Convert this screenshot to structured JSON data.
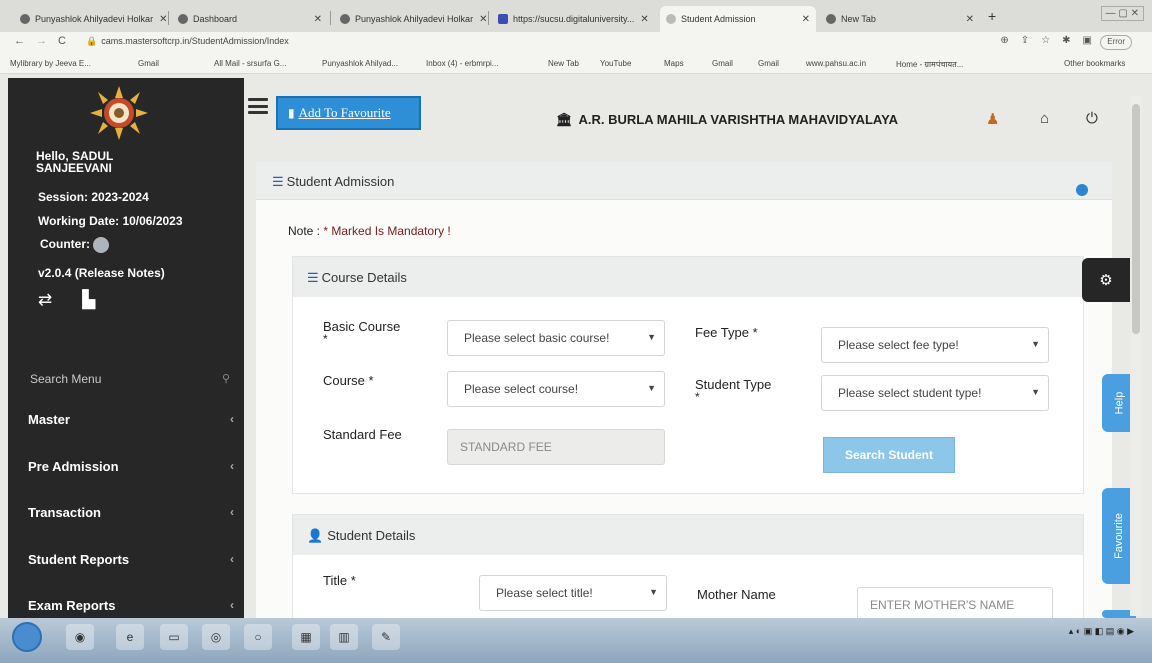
{
  "browser": {
    "tabs": [
      {
        "title": "Punyashlok Ahilyadevi Holkar"
      },
      {
        "title": "Dashboard"
      },
      {
        "title": "Punyashlok Ahilyadevi Holkar"
      },
      {
        "title": "https://sucsu.digitaluniversity..."
      },
      {
        "title": "Student Admission"
      },
      {
        "title": "New Tab"
      }
    ],
    "url": "cams.mastersoftcrp.in/StudentAdmission/Index",
    "profile_label": "Error",
    "bookmarks": [
      "Mylibrary by Jeeva E...",
      "Gmail",
      "All Mail - srsurfa G...",
      "Punyashlok Ahilyad...",
      "Inbox (4) - erbmrpi...",
      "New Tab",
      "YouTube",
      "Maps",
      "Gmail",
      "Gmail",
      "www.pahsu.ac.in",
      "Home - ग्रामपंचायत...",
      "Other bookmarks"
    ]
  },
  "sidebar": {
    "greeting": "Hello, SADUL SANJEEVANI",
    "session": "Session: 2023-2024",
    "working_date": "Working Date: 10/06/2023",
    "counter_label": "Counter:",
    "version": "v2.0.4 (Release Notes)",
    "search_label": "Search Menu",
    "menu": [
      {
        "label": "Master"
      },
      {
        "label": "Pre Admission"
      },
      {
        "label": "Transaction"
      },
      {
        "label": "Student Reports"
      },
      {
        "label": "Exam Reports"
      }
    ]
  },
  "header": {
    "favourite_button": "Add To Favourite",
    "college_name": "A.R. BURLA MAHILA VARISHTHA MAHAVIDYALAYA"
  },
  "panel": {
    "title": "Student Admission",
    "note_prefix": "Note : ",
    "note_text": "* Marked Is Mandatory !"
  },
  "course_details": {
    "title": "Course Details",
    "basic_course_label": "Basic Course",
    "basic_course_placeholder": "Please select basic course!",
    "fee_type_label": "Fee Type *",
    "fee_type_placeholder": "Please select fee type!",
    "course_label": "Course *",
    "course_placeholder": "Please select course!",
    "student_type_label": "Student Type",
    "student_type_placeholder": "Please select student type!",
    "standard_fee_label": "Standard Fee",
    "standard_fee_placeholder": "STANDARD FEE",
    "search_button": "Search Student"
  },
  "student_details": {
    "title": "Student Details",
    "title_label": "Title *",
    "title_placeholder": "Please select title!",
    "mother_name_label": "Mother Name",
    "mother_name_placeholder": "ENTER MOTHER'S NAME"
  },
  "side_tabs": {
    "help": "Help",
    "favourite": "Favourite"
  },
  "colors": {
    "sidebar_bg": "#272727",
    "accent_blue": "#2e8fd6",
    "note_red": "#7a1b14",
    "search_button": "#8cc6e9"
  }
}
